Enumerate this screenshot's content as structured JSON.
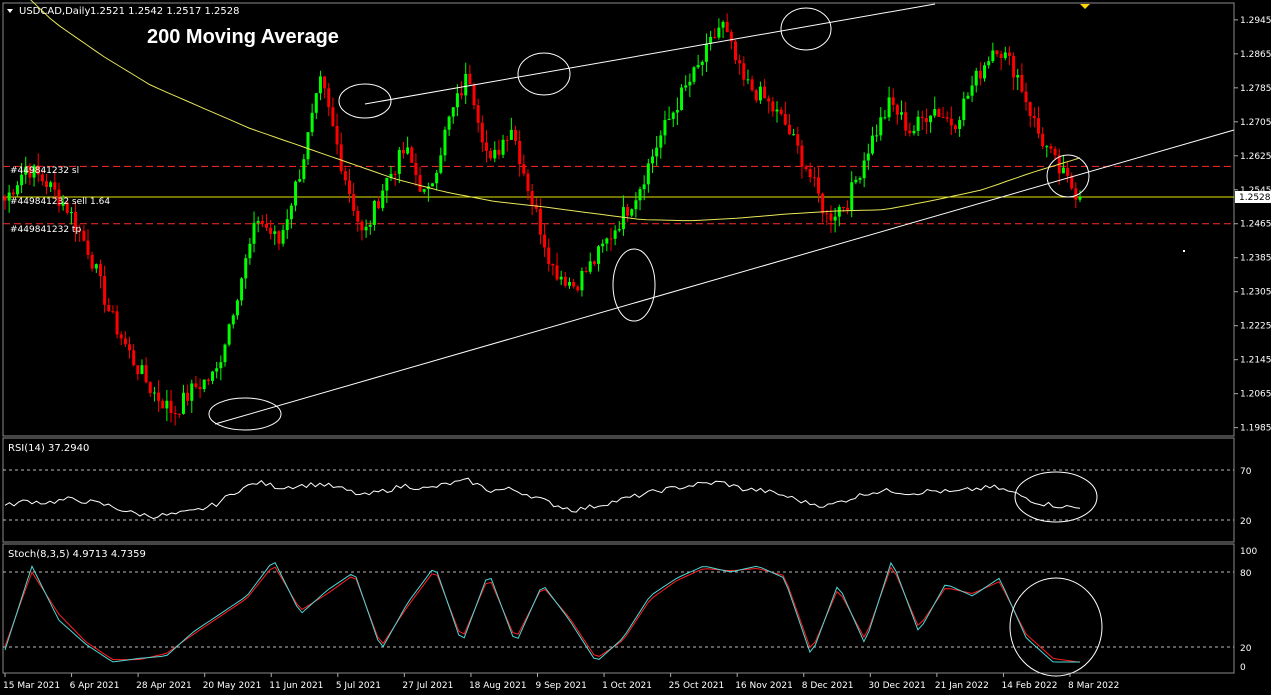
{
  "header": {
    "symbol": "USDCAD,Daily",
    "ohlc": "1.2521 1.2542 1.2517 1.2528"
  },
  "annotation_title": "200 Moving Average",
  "orders": {
    "sl": "#449841232 sl",
    "sell": "#449841232 sell 1.64",
    "tp": "#449841232 tp"
  },
  "current_price_label": "1.2528",
  "rsi": {
    "label": "RSI(14) 37.2940",
    "levels": [
      "70",
      "20"
    ]
  },
  "stoch": {
    "label": "Stoch(8,3,5) 4.9713 4.7359",
    "levels": [
      "100",
      "80",
      "20",
      "0"
    ]
  },
  "colors": {
    "bull": "#00ff00",
    "bear": "#ff0000",
    "ma": "#e8e85a",
    "sell_line": "#ffff00",
    "stop": "#ff0000",
    "stoch_main": "#4fd8d8",
    "stoch_signal": "#ff2020"
  },
  "chart_data": {
    "type": "candlestick",
    "timeframe": "Daily",
    "y_ticks": [
      "1.2945",
      "1.2865",
      "1.2785",
      "1.2705",
      "1.2625",
      "1.2545",
      "1.2465",
      "1.2385",
      "1.2305",
      "1.2225",
      "1.2145",
      "1.2065",
      "1.1985"
    ],
    "ylim": [
      1.197,
      1.298
    ],
    "x_ticks": [
      "15 Mar 2021",
      "6 Apr 2021",
      "28 Apr 2021",
      "20 May 2021",
      "11 Jun 2021",
      "5 Jul 2021",
      "27 Jul 2021",
      "18 Aug 2021",
      "9 Sep 2021",
      "1 Oct 2021",
      "25 Oct 2021",
      "16 Nov 2021",
      "8 Dec 2021",
      "30 Dec 2021",
      "21 Jan 2022",
      "14 Feb 2022",
      "8 Mar 2022"
    ],
    "price_path": [
      1.252,
      1.26,
      1.256,
      1.25,
      1.24,
      1.225,
      1.215,
      1.207,
      1.202,
      1.208,
      1.211,
      1.23,
      1.248,
      1.242,
      1.259,
      1.28,
      1.26,
      1.243,
      1.256,
      1.264,
      1.252,
      1.27,
      1.282,
      1.26,
      1.27,
      1.252,
      1.236,
      1.232,
      1.238,
      1.246,
      1.254,
      1.266,
      1.276,
      1.284,
      1.294,
      1.28,
      1.276,
      1.27,
      1.26,
      1.248,
      1.252,
      1.265,
      1.275,
      1.268,
      1.274,
      1.27,
      1.28,
      1.289,
      1.282,
      1.268,
      1.259,
      1.2528
    ],
    "ma200": [
      1.305,
      1.294,
      1.286,
      1.279,
      1.274,
      1.269,
      1.265,
      1.261,
      1.257,
      1.254,
      1.2518,
      1.2505,
      1.249,
      1.2475,
      1.2472,
      1.2478,
      1.2488,
      1.2495,
      1.2498,
      1.252,
      1.2545,
      1.2585,
      1.262
    ],
    "levels": {
      "stop_loss": 1.26,
      "sell_entry": 1.2528,
      "take_profit": 1.2465,
      "current": 1.2528
    },
    "rsi_series": [
      40,
      46,
      44,
      48,
      45,
      40,
      32,
      28,
      30,
      34,
      42,
      58,
      68,
      62,
      64,
      66,
      60,
      52,
      58,
      64,
      60,
      66,
      70,
      58,
      60,
      52,
      42,
      35,
      40,
      46,
      52,
      58,
      62,
      66,
      68,
      60,
      58,
      52,
      44,
      40,
      48,
      56,
      58,
      55,
      58,
      56,
      60,
      62,
      54,
      44,
      40,
      37.29
    ],
    "rsi_ylim": [
      0,
      100
    ],
    "stoch_main": [
      15,
      85,
      40,
      20,
      5,
      8,
      10,
      30,
      45,
      60,
      90,
      45,
      65,
      80,
      15,
      55,
      85,
      20,
      80,
      20,
      70,
      40,
      5,
      25,
      60,
      75,
      85,
      80,
      85,
      75,
      10,
      70,
      20,
      90,
      30,
      70,
      60,
      75,
      25,
      5,
      4.97
    ],
    "stoch_signal": [
      18,
      80,
      45,
      22,
      7,
      7,
      12,
      28,
      43,
      58,
      86,
      48,
      62,
      78,
      18,
      52,
      82,
      24,
      76,
      24,
      68,
      42,
      8,
      23,
      57,
      73,
      83,
      81,
      83,
      77,
      14,
      66,
      24,
      86,
      34,
      67,
      62,
      72,
      28,
      8,
      4.74
    ],
    "stoch_ylim": [
      0,
      100
    ]
  }
}
